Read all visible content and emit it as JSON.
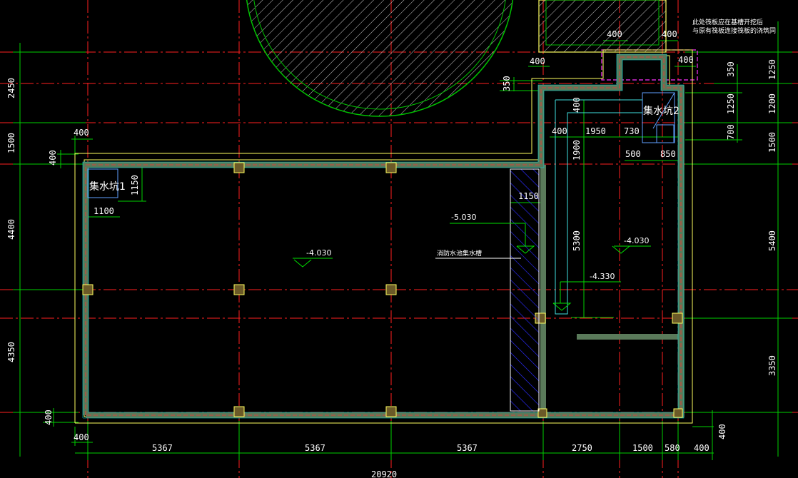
{
  "dims": {
    "bottom": [
      "5367",
      "5367",
      "5367",
      "2750",
      "1500",
      "580",
      "400"
    ],
    "bottom_total": "20920",
    "left": [
      "2450",
      "1500",
      "4400",
      "4350"
    ],
    "right": [
      "1250",
      "1200",
      "1500",
      "5400",
      "3350"
    ],
    "right_inner": [
      "350",
      "1250",
      "700"
    ],
    "misc": {
      "d400_top_a": "400",
      "d400_top_b": "400",
      "d400_top_c": "400",
      "d400_top_d": "400",
      "d350": "350",
      "d400_left": "400",
      "d400_leftv": "400",
      "d400_bl": "400",
      "d400_blv": "400",
      "d400_br": "400",
      "d1150_pit1": "1150",
      "d1100_pit1": "1100",
      "d1150_tank": "1150",
      "d400_p2": "400",
      "d1950": "1950",
      "d730": "730",
      "d500": "500",
      "d850": "850",
      "d400_p2v": "400",
      "d1900": "1900",
      "d5300": "5300"
    }
  },
  "levels": {
    "main": "-4.030",
    "tank": "-5.030",
    "right": "-4.030",
    "ramp": "-4.330"
  },
  "labels": {
    "pit1": "集水坑1",
    "pit2": "集水坑2",
    "tank": "消防水池集水槽",
    "note_line1": "此处筏板应在基槽开挖后",
    "note_line2": "与原有筏板连接筏板的浇筑同"
  }
}
